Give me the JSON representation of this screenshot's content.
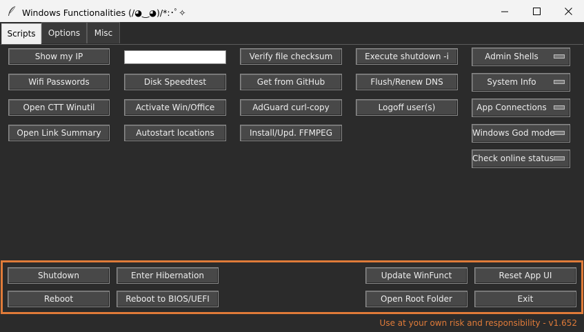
{
  "window": {
    "title": "Windows Functionalities (/◕‿◕)/*:･ﾟ✧",
    "controls": {
      "minimize": "minimize",
      "maximize": "maximize",
      "close": "close"
    }
  },
  "tabs": [
    "Scripts",
    "Options",
    "Misc"
  ],
  "active_tab": "Scripts",
  "scripts": {
    "col1": [
      "Show my IP",
      "Wifi Passwords",
      "Open CTT Winutil",
      "Open Link Summary"
    ],
    "col2": [
      "Disk Speedtest",
      "Activate Win/Office",
      "Autostart locations"
    ],
    "text_input_value": "",
    "col3": [
      "Verify file checksum",
      "Get from GitHub",
      "AdGuard curl-copy",
      "Install/Upd. FFMPEG"
    ],
    "col4": [
      "Execute shutdown -i",
      "Flush/Renew DNS",
      "Logoff user(s)"
    ],
    "menus": [
      "Admin Shells",
      "System Info",
      "App Connections",
      "Windows God mode",
      "Check online status"
    ]
  },
  "footer": {
    "shutdown": "Shutdown",
    "hibernate": "Enter Hibernation",
    "update": "Update WinFunct",
    "reset_ui": "Reset App UI",
    "reboot": "Reboot",
    "reboot_bios": "Reboot to BIOS/UEFI",
    "open_root": "Open Root Folder",
    "exit": "Exit"
  },
  "disclaimer": "Use at your own risk and responsibility - v1.652",
  "colors": {
    "background": "#2b2b2b",
    "button": "#484848",
    "accent": "#e07b39",
    "titlebar": "#f3f3f3"
  }
}
